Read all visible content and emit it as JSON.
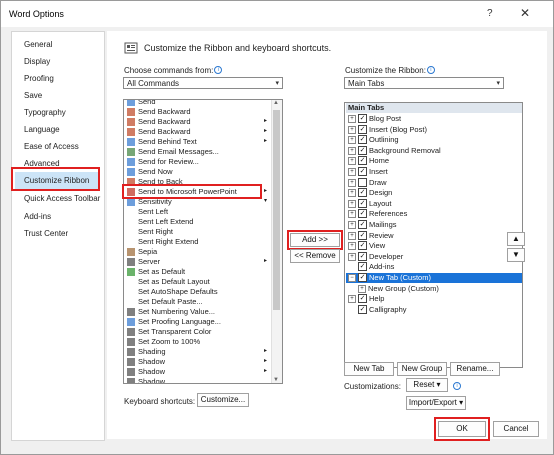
{
  "window": {
    "title": "Word Options",
    "help": "?",
    "close": "✕"
  },
  "nav": [
    "General",
    "Display",
    "Proofing",
    "Save",
    "Typography",
    "Language",
    "Ease of Access",
    "Advanced",
    "Customize Ribbon",
    "Quick Access Toolbar",
    "Add-ins",
    "Trust Center"
  ],
  "header": {
    "text": "Customize the Ribbon and keyboard shortcuts."
  },
  "left": {
    "label": "Choose commands from:",
    "select": "All Commands",
    "items": [
      "Send",
      "Send Backward",
      "Send Backward",
      "Send Backward",
      "Send Behind Text",
      "Send Email Messages...",
      "Send for Review...",
      "Send Now",
      "Send to Back",
      "Send to Microsoft PowerPoint",
      "Sensitivity",
      "Sent Left",
      "Sent Left Extend",
      "Sent Right",
      "Sent Right Extend",
      "Sepia",
      "Server",
      "Set as Default",
      "Set as Default Layout",
      "Set AutoShape Defaults",
      "Set Default Paste...",
      "Set Numbering Value...",
      "Set Proofing Language...",
      "Set Transparent Color",
      "Set Zoom to 100%",
      "Shading",
      "Shadow",
      "Shadow",
      "Shadow"
    ],
    "keyboard_label": "Keyboard shortcuts:",
    "customize_btn": "Customize..."
  },
  "middle": {
    "add": "Add >>",
    "remove": "<< Remove"
  },
  "right": {
    "label": "Customize the Ribbon:",
    "select": "Main Tabs",
    "tree_header": "Main Tabs",
    "items": [
      {
        "label": "Blog Post",
        "exp": "+",
        "checked": true,
        "indent": 0
      },
      {
        "label": "Insert (Blog Post)",
        "exp": "+",
        "checked": true,
        "indent": 0
      },
      {
        "label": "Outlining",
        "exp": "+",
        "checked": true,
        "indent": 0
      },
      {
        "label": "Background Removal",
        "exp": "+",
        "checked": true,
        "indent": 0
      },
      {
        "label": "Home",
        "exp": "+",
        "checked": true,
        "indent": 0
      },
      {
        "label": "Insert",
        "exp": "+",
        "checked": true,
        "indent": 0
      },
      {
        "label": "Draw",
        "exp": "+",
        "checked": false,
        "indent": 0
      },
      {
        "label": "Design",
        "exp": "+",
        "checked": true,
        "indent": 0
      },
      {
        "label": "Layout",
        "exp": "+",
        "checked": true,
        "indent": 0
      },
      {
        "label": "References",
        "exp": "+",
        "checked": true,
        "indent": 0
      },
      {
        "label": "Mailings",
        "exp": "+",
        "checked": true,
        "indent": 0
      },
      {
        "label": "Review",
        "exp": "+",
        "checked": true,
        "indent": 0
      },
      {
        "label": "View",
        "exp": "+",
        "checked": true,
        "indent": 0
      },
      {
        "label": "Developer",
        "exp": "+",
        "checked": true,
        "indent": 0
      },
      {
        "label": "Add-ins",
        "exp": "",
        "checked": true,
        "indent": 0
      },
      {
        "label": "New Tab (Custom)",
        "exp": "−",
        "checked": true,
        "indent": 0,
        "selected": true
      },
      {
        "label": "New Group (Custom)",
        "exp": "+",
        "checked": null,
        "indent": 1
      },
      {
        "label": "Help",
        "exp": "+",
        "checked": true,
        "indent": 0
      },
      {
        "label": "Calligraphy",
        "exp": "",
        "checked": true,
        "indent": 0
      }
    ],
    "new_tab": "New Tab",
    "new_group": "New Group",
    "rename": "Rename...",
    "customizations_label": "Customizations:",
    "reset": "Reset ▾",
    "import_export": "Import/Export ▾",
    "up": "▲",
    "down": "▼"
  },
  "footer": {
    "ok": "OK",
    "cancel": "Cancel"
  }
}
